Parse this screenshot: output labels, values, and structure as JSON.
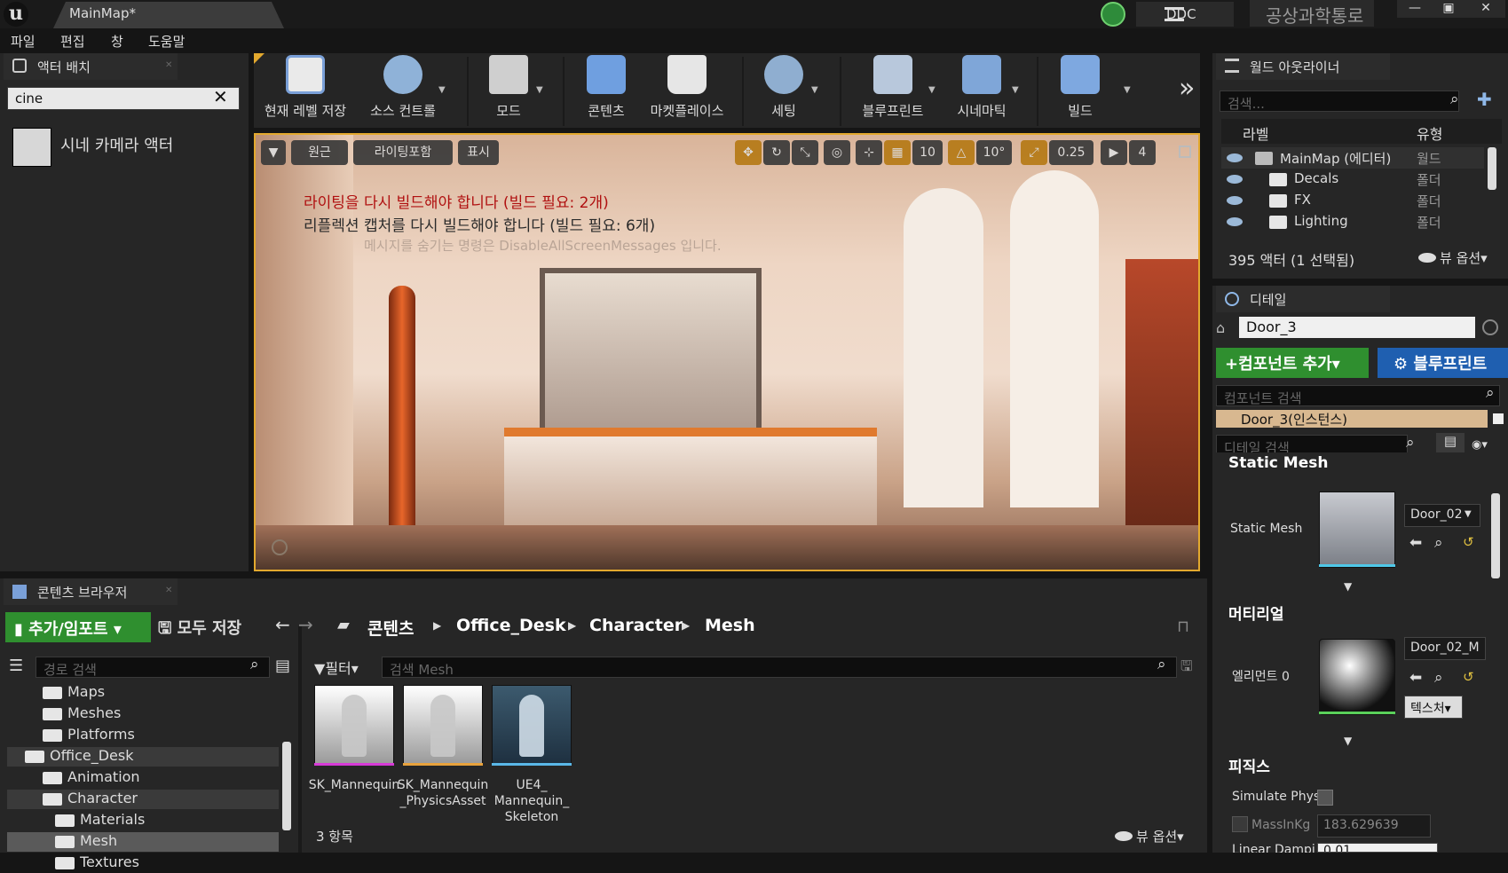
{
  "title_bar": {
    "logo": "u",
    "tab_title": "MainMap*",
    "ddc_label": "DDC",
    "project_name": "공상과학통로",
    "window_controls": [
      "—",
      "▣",
      "✕"
    ]
  },
  "menu": [
    "파일",
    "편집",
    "창",
    "도움말"
  ],
  "actor_place": {
    "tab_label": "액터 배치",
    "search_value": "cine",
    "results": [
      {
        "label": "시네 카메라 액터"
      }
    ]
  },
  "toolbar": {
    "buttons": [
      {
        "label": "현재 레벨 저장"
      },
      {
        "label": "소스 컨트롤"
      },
      {
        "label": "모드"
      },
      {
        "label": "콘텐츠"
      },
      {
        "label": "마켓플레이스"
      },
      {
        "label": "세팅"
      },
      {
        "label": "블루프린트"
      },
      {
        "label": "시네마틱"
      },
      {
        "label": "빌드"
      }
    ],
    "more": "»"
  },
  "viewport": {
    "perspective_label": "원근",
    "lighting_label": "라이팅포함",
    "show_label": "표시",
    "grid_snap": "10",
    "rotation_snap": "10°",
    "scale_snap": "0.25",
    "camera_speed": "4",
    "messages": {
      "lighting": "라이팅을 다시 빌드해야 합니다 (빌드 필요: 2개)",
      "reflection": "리플렉션 캡처를 다시 빌드해야 합니다 (빌드 필요: 6개)",
      "hint": "메시지를 숨기는 명령은 DisableAllScreenMessages 입니다."
    }
  },
  "world_outliner": {
    "tab_label": "월드 아웃라이너",
    "search_placeholder": "검색...",
    "col_label": "라벨",
    "col_type": "유형",
    "rows": [
      {
        "label": "MainMap (에디터)",
        "type": "월드"
      },
      {
        "label": "Decals",
        "type": "폴더"
      },
      {
        "label": "FX",
        "type": "폴더"
      },
      {
        "label": "Lighting",
        "type": "폴더"
      }
    ],
    "summary": "395 액터 (1 선택됨)",
    "view_options": "뷰 옵션"
  },
  "details": {
    "tab_label": "디테일",
    "actor_name": "Door_3",
    "add_component": "컴포넌트 추가",
    "blueprint": "블루프린트",
    "component_search_placeholder": "컴포넌트 검색",
    "instance_label": "Door_3(인스턴스)",
    "detail_search_placeholder": "디테일 검색",
    "static_mesh_section": "Static Mesh",
    "static_mesh_label": "Static Mesh",
    "static_mesh_value": "Door_02",
    "material_section": "머티리얼",
    "element_label": "엘리먼트 0",
    "material_value": "Door_02_M",
    "texture_label": "텍스처",
    "physics_section": "피직스",
    "simulate_label": "Simulate Phys",
    "mass_label": "MassInKg",
    "mass_value": "183.629639",
    "linear_label": "Linear Dampi",
    "linear_value": "0.01"
  },
  "content_browser": {
    "tab_label": "콘텐츠 브라우저",
    "add_import": "추가/임포트",
    "save_all": "모두 저장",
    "breadcrumb": [
      "콘텐츠",
      "Office_Desk",
      "Character",
      "Mesh"
    ],
    "path_search_placeholder": "경로 검색",
    "filter_label": "필터",
    "asset_search_placeholder": "검색 Mesh",
    "tree": [
      {
        "label": "Maps"
      },
      {
        "label": "Meshes"
      },
      {
        "label": "Platforms"
      },
      {
        "label": "Office_Desk"
      },
      {
        "label": "Animation"
      },
      {
        "label": "Character"
      },
      {
        "label": "Materials"
      },
      {
        "label": "Mesh"
      },
      {
        "label": "Textures"
      }
    ],
    "assets": [
      {
        "name": "SK_Mannequin",
        "bar_color": "#d63ad6"
      },
      {
        "name": "SK_Mannequin\n_PhysicsAsset",
        "bar_color": "#e8a23c"
      },
      {
        "name": "UE4_\nMannequin_\nSkeleton",
        "bar_color": "#5ab8e8"
      }
    ],
    "item_count": "3 항목",
    "view_options": "뷰 옵션"
  },
  "colors": {
    "accent_orange": "#e3a92e",
    "add_green": "#2f8f2f",
    "blueprint_blue": "#1f5fb0"
  }
}
